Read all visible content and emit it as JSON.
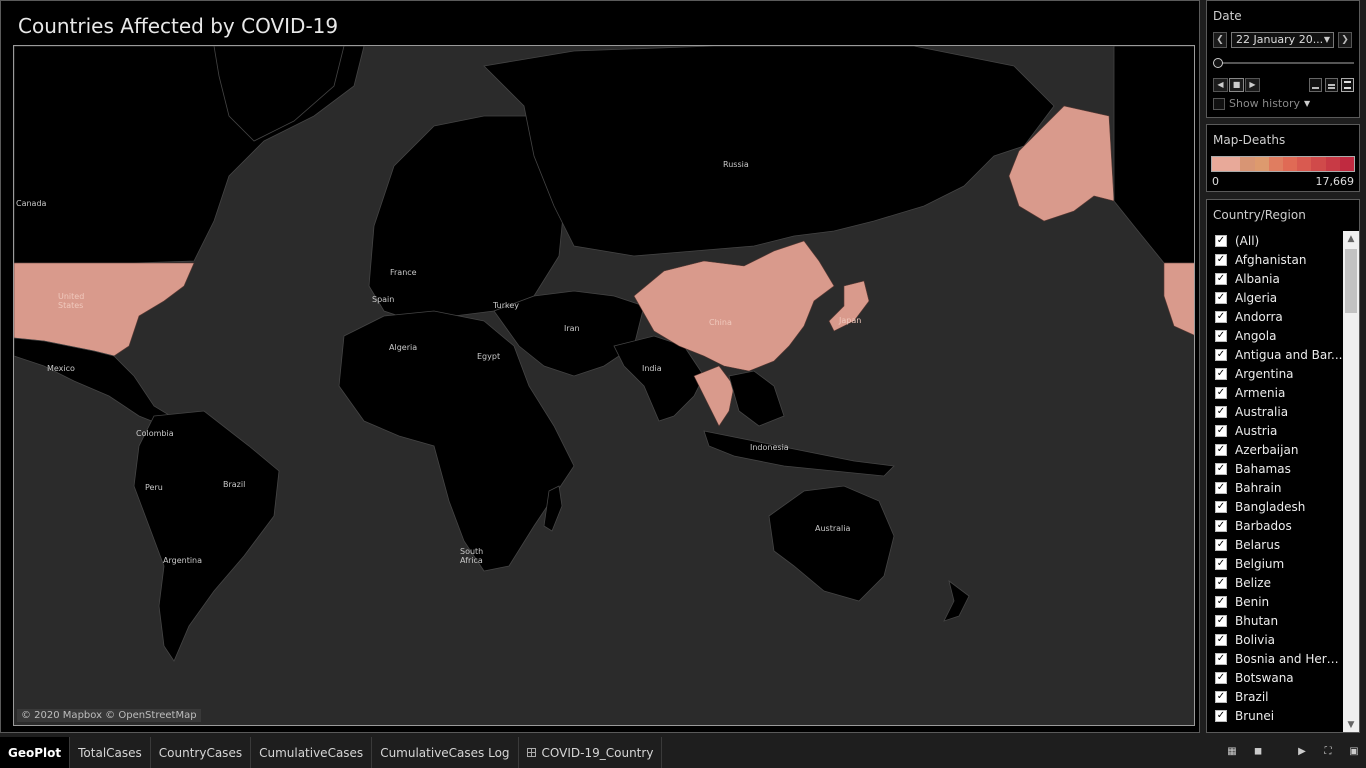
{
  "map": {
    "title": "Countries Affected by COVID-19",
    "attribution": "© 2020 Mapbox © OpenStreetMap",
    "labels": {
      "canada": "Canada",
      "united_states_1": "United",
      "united_states_2": "States",
      "mexico": "Mexico",
      "colombia": "Colombia",
      "peru": "Peru",
      "brazil": "Brazil",
      "argentina": "Argentina",
      "france": "France",
      "spain": "Spain",
      "turkey": "Turkey",
      "russia": "Russia",
      "algeria": "Algeria",
      "egypt": "Egypt",
      "iran": "Iran",
      "india": "India",
      "china": "China",
      "japan": "Japan",
      "indonesia": "Indonesia",
      "australia": "Australia",
      "south_africa_1": "South",
      "south_africa_2": "Africa"
    },
    "colors": {
      "ocean": "#2b2b2b",
      "land": "#000000",
      "affected": "#d99a8c",
      "border": "#444444"
    },
    "highlighted_countries": [
      "United States",
      "China",
      "Japan",
      "Thailand"
    ]
  },
  "date_filter": {
    "title": "Date",
    "value": "22 January 20...",
    "slider_fraction": 0,
    "show_history_label": "Show history"
  },
  "legend": {
    "title": "Map-Deaths",
    "min_label": "0",
    "max_label": "17,669",
    "colors": [
      "#e8a999",
      "#e8a999",
      "#d89574",
      "#dd9a6e",
      "#e07d60",
      "#e06a55",
      "#d95a50",
      "#d04a4a",
      "#c83a45",
      "#c02a40"
    ]
  },
  "country_filter": {
    "title": "Country/Region",
    "items": [
      "(All)",
      "Afghanistan",
      "Albania",
      "Algeria",
      "Andorra",
      "Angola",
      "Antigua and Bar...",
      "Argentina",
      "Armenia",
      "Australia",
      "Austria",
      "Azerbaijan",
      "Bahamas",
      "Bahrain",
      "Bangladesh",
      "Barbados",
      "Belarus",
      "Belgium",
      "Belize",
      "Benin",
      "Bhutan",
      "Bolivia",
      "Bosnia and Herz...",
      "Botswana",
      "Brazil",
      "Brunei"
    ]
  },
  "tabs": [
    {
      "label": "GeoPlot",
      "active": true
    },
    {
      "label": "TotalCases",
      "active": false
    },
    {
      "label": "CountryCases",
      "active": false
    },
    {
      "label": "CumulativeCases",
      "active": false
    },
    {
      "label": "CumulativeCases Log",
      "active": false
    },
    {
      "label": "COVID-19_Country",
      "active": false
    }
  ]
}
